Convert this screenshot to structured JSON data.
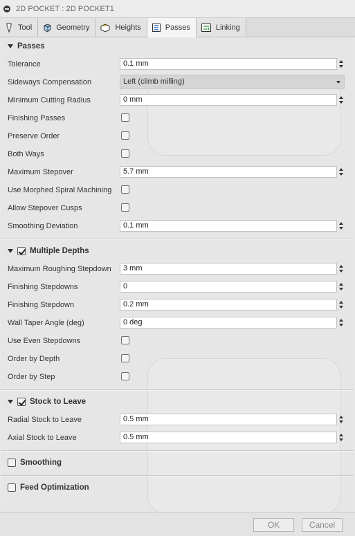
{
  "window": {
    "title": "2D POCKET : 2D POCKET1"
  },
  "tabs": [
    {
      "label": "Tool",
      "icon": "tool-icon"
    },
    {
      "label": "Geometry",
      "icon": "geometry-icon"
    },
    {
      "label": "Heights",
      "icon": "heights-icon"
    },
    {
      "label": "Passes",
      "icon": "passes-icon",
      "active": true
    },
    {
      "label": "Linking",
      "icon": "linking-icon"
    }
  ],
  "passes": {
    "header": "Passes",
    "tolerance": {
      "label": "Tolerance",
      "value": "0.1 mm"
    },
    "sideways": {
      "label": "Sideways Compensation",
      "value": "Left (climb milling)"
    },
    "min_cut_radius": {
      "label": "Minimum Cutting Radius",
      "value": "0 mm"
    },
    "finishing_passes": {
      "label": "Finishing Passes",
      "checked": false
    },
    "preserve_order": {
      "label": "Preserve Order",
      "checked": false
    },
    "both_ways": {
      "label": "Both Ways",
      "checked": false
    },
    "max_stepover": {
      "label": "Maximum Stepover",
      "value": "5.7 mm"
    },
    "morphed_spiral": {
      "label": "Use Morphed Spiral Machining",
      "checked": false
    },
    "allow_cusps": {
      "label": "Allow Stepover Cusps",
      "checked": false
    },
    "smoothing_dev": {
      "label": "Smoothing Deviation",
      "value": "0.1 mm"
    }
  },
  "multiple_depths": {
    "header": "Multiple Depths",
    "enabled": true,
    "max_rough": {
      "label": "Maximum Roughing Stepdown",
      "value": "3 mm"
    },
    "fin_stepdowns": {
      "label": "Finishing Stepdowns",
      "value": "0"
    },
    "fin_stepdown": {
      "label": "Finishing Stepdown",
      "value": "0.2 mm"
    },
    "taper": {
      "label": "Wall Taper Angle (deg)",
      "value": "0 deg"
    },
    "even": {
      "label": "Use Even Stepdowns",
      "checked": false
    },
    "by_depth": {
      "label": "Order by Depth",
      "checked": false
    },
    "by_step": {
      "label": "Order by Step",
      "checked": false
    }
  },
  "stock": {
    "header": "Stock to Leave",
    "enabled": true,
    "radial": {
      "label": "Radial Stock to Leave",
      "value": "0.5 mm"
    },
    "axial": {
      "label": "Axial Stock to Leave",
      "value": "0.5 mm"
    }
  },
  "smoothing": {
    "header": "Smoothing",
    "enabled": false
  },
  "feed_opt": {
    "header": "Feed Optimization",
    "enabled": false
  },
  "footer": {
    "ok": "OK",
    "cancel": "Cancel"
  }
}
